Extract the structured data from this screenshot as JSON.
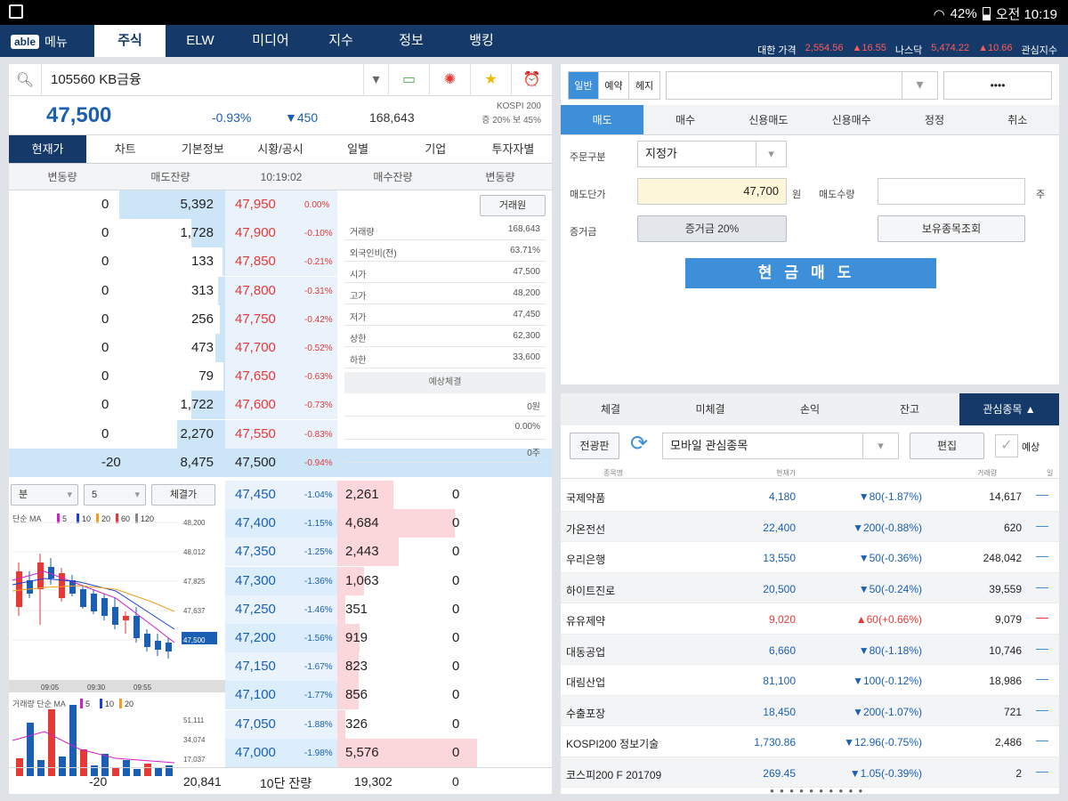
{
  "statusbar": {
    "battery": "42%",
    "time": "오전 10:19"
  },
  "topnav": {
    "logo": "able",
    "menu": "메뉴",
    "tabs": [
      "주식",
      "ELW",
      "미디어",
      "지수",
      "정보",
      "뱅킹"
    ],
    "ticker": [
      {
        "name": "대한 가격",
        "value": "2,554.56",
        "change": "▲16.55"
      },
      {
        "name": "나스닥",
        "value": "5,474.22",
        "change": "▲10.66"
      },
      {
        "name": "",
        "value": "관심지수",
        "change": ""
      }
    ]
  },
  "stock": {
    "code_name": "105560 KB금융",
    "price": "47,500",
    "pct": "-0.93%",
    "change": "▼450",
    "volume": "168,643",
    "market_line1": "KOSPI 200",
    "market_line2": "증 20% 보 45%"
  },
  "subtabs": [
    "현재가",
    "차트",
    "기본정보",
    "시황/공시",
    "일별",
    "기업",
    "투자자별"
  ],
  "ob_header": [
    "변동량",
    "매도잔량",
    "10:19:02",
    "매수잔량",
    "변동량"
  ],
  "asks": [
    {
      "chg": "0",
      "qty": "5,392",
      "price": "47,950",
      "pct": "0.00%",
      "bar": 0.78
    },
    {
      "chg": "0",
      "qty": "1,728",
      "price": "47,900",
      "pct": "-0.10%",
      "bar": 0.25
    },
    {
      "chg": "0",
      "qty": "133",
      "price": "47,850",
      "pct": "-0.21%",
      "bar": 0.02
    },
    {
      "chg": "0",
      "qty": "313",
      "price": "47,800",
      "pct": "-0.31%",
      "bar": 0.05
    },
    {
      "chg": "0",
      "qty": "256",
      "price": "47,750",
      "pct": "-0.42%",
      "bar": 0.04
    },
    {
      "chg": "0",
      "qty": "473",
      "price": "47,700",
      "pct": "-0.52%",
      "bar": 0.07
    },
    {
      "chg": "0",
      "qty": "79",
      "price": "47,650",
      "pct": "-0.63%",
      "bar": 0.01
    },
    {
      "chg": "0",
      "qty": "1,722",
      "price": "47,600",
      "pct": "-0.73%",
      "bar": 0.25
    },
    {
      "chg": "0",
      "qty": "2,270",
      "price": "47,550",
      "pct": "-0.83%",
      "bar": 0.35
    },
    {
      "chg": "-20",
      "qty": "8,475",
      "price": "47,500",
      "pct": "-0.94%",
      "bar": 1.0
    }
  ],
  "bids": [
    {
      "price": "47,450",
      "pct": "-1.04%",
      "qty": "2,261",
      "chg": "0",
      "bar": 0.4
    },
    {
      "price": "47,400",
      "pct": "-1.15%",
      "qty": "4,684",
      "chg": "0",
      "bar": 0.84
    },
    {
      "price": "47,350",
      "pct": "-1.25%",
      "qty": "2,443",
      "chg": "0",
      "bar": 0.44
    },
    {
      "price": "47,300",
      "pct": "-1.36%",
      "qty": "1,063",
      "chg": "0",
      "bar": 0.19
    },
    {
      "price": "47,250",
      "pct": "-1.46%",
      "qty": "351",
      "chg": "0",
      "bar": 0.06
    },
    {
      "price": "47,200",
      "pct": "-1.56%",
      "qty": "919",
      "chg": "0",
      "bar": 0.16
    },
    {
      "price": "47,150",
      "pct": "-1.67%",
      "qty": "823",
      "chg": "0",
      "bar": 0.15
    },
    {
      "price": "47,100",
      "pct": "-1.77%",
      "qty": "856",
      "chg": "0",
      "bar": 0.15
    },
    {
      "price": "47,050",
      "pct": "-1.88%",
      "qty": "326",
      "chg": "0",
      "bar": 0.06
    },
    {
      "price": "47,000",
      "pct": "-1.98%",
      "qty": "5,576",
      "chg": "0",
      "bar": 1.0
    }
  ],
  "info": {
    "trade_btn": "거래원",
    "rows": [
      {
        "k": "거래량",
        "v": "168,643"
      },
      {
        "k": "외국인비(전)",
        "v": "63.71%"
      },
      {
        "k": "시가",
        "v": "47,500"
      },
      {
        "k": "고가",
        "v": "48,200"
      },
      {
        "k": "저가",
        "v": "47,450"
      },
      {
        "k": "상한",
        "v": "62,300"
      },
      {
        "k": "하한",
        "v": "33,600"
      }
    ],
    "expect_label": "예상체결",
    "expect_rows": [
      "0원",
      "0.00%",
      "0주"
    ]
  },
  "chart": {
    "period": "분",
    "interval": "5",
    "btn": "체결가",
    "ma_label": "단순 MA",
    "ma_legend": [
      "5",
      "10",
      "20",
      "60",
      "120"
    ],
    "y_labels": [
      "48,200",
      "48,012",
      "47,825",
      "47,637",
      "47,500"
    ],
    "x_labels": [
      "09:05",
      "09:30",
      "09:55"
    ],
    "vol_label": "거래량 단순 MA",
    "vol_legend": [
      "5",
      "10",
      "20"
    ],
    "vol_y": [
      "51,111",
      "34,074",
      "17,037"
    ]
  },
  "summary": {
    "ask_chg": "-20",
    "ask_total": "20,841",
    "label": "10단 잔량",
    "bid_total": "19,302",
    "bid_chg": "0"
  },
  "order": {
    "modes": [
      "일반",
      "예약",
      "헤지"
    ],
    "account_btn": "••••",
    "tabs": [
      "매도",
      "매수",
      "신용매도",
      "신용매수",
      "정정",
      "취소"
    ],
    "type_label": "주문구분",
    "type_value": "지정가",
    "price_label": "매도단가",
    "price_value": "47,700",
    "price_unit": "원",
    "qty_label": "매도수량",
    "qty_unit": "주",
    "margin_label": "증거금",
    "margin_btn": "증거금 20%",
    "holdings_btn": "보유종목조회",
    "submit": "현금매도"
  },
  "watch": {
    "tabs": [
      "체결",
      "미체결",
      "손익",
      "잔고",
      "관심종목 ▲"
    ],
    "all_btn": "전광판",
    "group": "모바일 관심종목",
    "edit_btn": "편집",
    "expect": "예상",
    "headers": [
      "종목명",
      "현재가",
      "",
      "거래량",
      "일"
    ],
    "rows": [
      {
        "name": "국제약품",
        "price": "4,180",
        "chg": "▼80(-1.87%)",
        "vol": "14,617",
        "dir": "down"
      },
      {
        "name": "가온전선",
        "price": "22,400",
        "chg": "▼200(-0.88%)",
        "vol": "620",
        "dir": "down"
      },
      {
        "name": "우리은행",
        "price": "13,550",
        "chg": "▼50(-0.36%)",
        "vol": "248,042",
        "dir": "down"
      },
      {
        "name": "하이트진로",
        "price": "20,500",
        "chg": "▼50(-0.24%)",
        "vol": "39,559",
        "dir": "down"
      },
      {
        "name": "유유제약",
        "price": "9,020",
        "chg": "▲60(+0.66%)",
        "vol": "9,079",
        "dir": "up"
      },
      {
        "name": "대동공업",
        "price": "6,660",
        "chg": "▼80(-1.18%)",
        "vol": "10,746",
        "dir": "down"
      },
      {
        "name": "대림산업",
        "price": "81,100",
        "chg": "▼100(-0.12%)",
        "vol": "18,986",
        "dir": "down"
      },
      {
        "name": "수출포장",
        "price": "18,450",
        "chg": "▼200(-1.07%)",
        "vol": "721",
        "dir": "down"
      },
      {
        "name": "KOSPI200 정보기술",
        "price": "1,730.86",
        "chg": "▼12.96(-0.75%)",
        "vol": "2,486",
        "dir": "down"
      },
      {
        "name": "코스피200 F 201709",
        "price": "269.45",
        "chg": "▼1.05(-0.39%)",
        "vol": "2",
        "dir": "down"
      }
    ]
  }
}
